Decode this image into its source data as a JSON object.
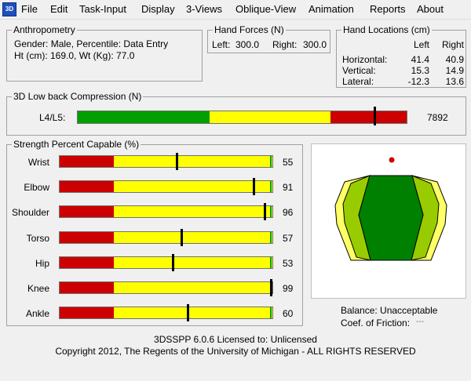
{
  "menu": {
    "app_icon": "3D",
    "items": [
      "File",
      "Edit",
      "Task-Input",
      "Display",
      "3-Views",
      "Oblique-View",
      "Animation",
      "Reports",
      "About"
    ]
  },
  "anthropometry": {
    "title": "Anthropometry",
    "line1": "Gender: Male, Percentile: Data Entry",
    "line2": "Ht (cm): 169.0, Wt (Kg): 77.0"
  },
  "hand_forces": {
    "title": "Hand Forces (N)",
    "left_label": "Left:",
    "left_value": "300.0",
    "right_label": "Right:",
    "right_value": "300.0"
  },
  "hand_locations": {
    "title": "Hand Locations (cm)",
    "col_left": "Left",
    "col_right": "Right",
    "rows": [
      {
        "label": "Horizontal:",
        "left": "41.4",
        "right": "40.9"
      },
      {
        "label": "Vertical:",
        "left": "15.3",
        "right": "14.9"
      },
      {
        "label": "Lateral:",
        "left": "-12.3",
        "right": "13.6"
      }
    ]
  },
  "low_back": {
    "title": "3D Low back Compression (N)",
    "label": "L4/L5:",
    "value": "7892",
    "level": 0.9
  },
  "strength": {
    "title": "Strength Percent Capable (%)",
    "rows": [
      {
        "label": "Wrist",
        "value": "55",
        "level": 0.55
      },
      {
        "label": "Elbow",
        "value": "91",
        "level": 0.91
      },
      {
        "label": "Shoulder",
        "value": "96",
        "level": 0.96
      },
      {
        "label": "Torso",
        "value": "57",
        "level": 0.57
      },
      {
        "label": "Hip",
        "value": "53",
        "level": 0.53
      },
      {
        "label": "Knee",
        "value": "99",
        "level": 0.99
      },
      {
        "label": "Ankle",
        "value": "60",
        "level": 0.6
      }
    ]
  },
  "balance": {
    "label": "Balance: Unacceptable",
    "friction_label": "Coef. of Friction:",
    "friction_value": "---"
  },
  "footer": {
    "line1": "3DSSPP 6.0.6 Licensed to: Unlicensed",
    "line2": "Copyright 2012, The Regents of the University of Michigan - ALL RIGHTS RESERVED"
  },
  "colors": {
    "red": "#cc0000",
    "yellow": "#ffff00",
    "green": "#00a000",
    "dark_green": "#008000",
    "light_green": "#99cc00",
    "pale_yellow": "#ffff66"
  }
}
